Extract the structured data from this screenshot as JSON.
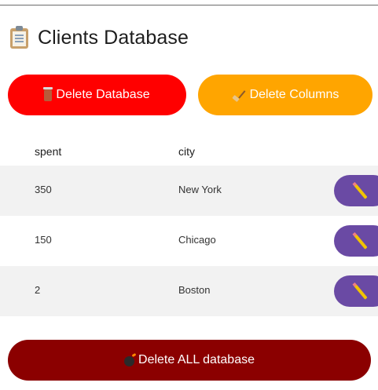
{
  "header": {
    "title": "Clients Database",
    "icon": "clipboard-icon"
  },
  "actions": {
    "delete_database_label": "Delete Database",
    "delete_columns_label": "Delete Columns",
    "delete_all_label": "Delete ALL database"
  },
  "table": {
    "columns": [
      "spent",
      "city"
    ],
    "rows": [
      {
        "spent": "350",
        "city": "New York"
      },
      {
        "spent": "150",
        "city": "Chicago"
      },
      {
        "spent": "2",
        "city": "Boston"
      }
    ]
  },
  "colors": {
    "delete_database": "#ff0000",
    "delete_columns": "#ffa500",
    "delete_all": "#8b0000",
    "edit_button": "#6a4aa4"
  }
}
